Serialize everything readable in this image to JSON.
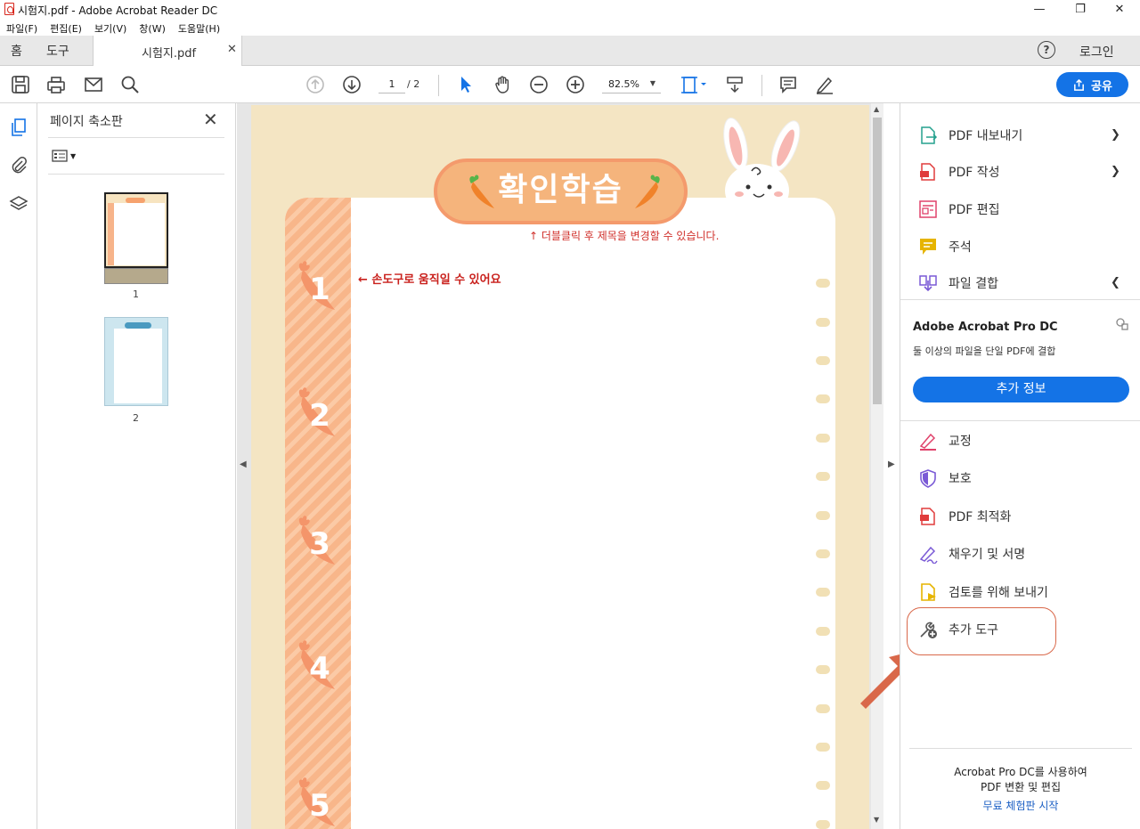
{
  "window": {
    "title": "시험지.pdf - Adobe Acrobat Reader DC",
    "controls": [
      "minimize",
      "restore",
      "close"
    ]
  },
  "menu": [
    "파일(F)",
    "편집(E)",
    "보기(V)",
    "창(W)",
    "도움말(H)"
  ],
  "tabs": {
    "home": "홈",
    "tools": "도구",
    "document": "시험지.pdf",
    "login": "로그인"
  },
  "toolbar": {
    "page_current": "1",
    "page_total": "/ 2",
    "zoom": "82.5%",
    "share_label": "공유"
  },
  "thumbnails": {
    "header": "페이지 축소판",
    "pages": [
      "1",
      "2"
    ]
  },
  "document": {
    "title": "확인학습",
    "hint_title": "↑ 더블클릭 후 제목을 변경할 수 있습니다.",
    "hint_hand": "← 손도구로 움직일 수 있어요",
    "numbers": [
      "1",
      "2",
      "3",
      "4",
      "5"
    ]
  },
  "right_panel": {
    "tools": [
      {
        "label": "PDF 내보내기",
        "icon": "export-pdf-icon",
        "chevron": "down"
      },
      {
        "label": "PDF 작성",
        "icon": "create-pdf-icon",
        "chevron": "down"
      },
      {
        "label": "PDF 편집",
        "icon": "edit-pdf-icon"
      },
      {
        "label": "주석",
        "icon": "comment-icon"
      },
      {
        "label": "파일 결합",
        "icon": "combine-files-icon",
        "chevron": "up"
      }
    ],
    "promo": {
      "title": "Adobe Acrobat Pro DC",
      "desc": "둘 이상의 파일을 단일 PDF에 결합",
      "button": "추가 정보"
    },
    "more_tools": [
      {
        "label": "교정",
        "icon": "redact-icon"
      },
      {
        "label": "보호",
        "icon": "protect-icon"
      },
      {
        "label": "PDF 최적화",
        "icon": "optimize-pdf-icon"
      },
      {
        "label": "채우기 및 서명",
        "icon": "fill-sign-icon"
      },
      {
        "label": "검토를 위해 보내기",
        "icon": "send-review-icon"
      },
      {
        "label": "추가 도구",
        "icon": "more-tools-icon"
      }
    ],
    "bottom": {
      "line1": "Acrobat Pro DC를 사용하여",
      "line2": "PDF 변환 및 편집",
      "trial": "무료 체험판 시작"
    }
  },
  "colors": {
    "accent": "#1473e6",
    "page_bg": "#f4e5c3",
    "stripe": "#f8b68a",
    "title_pill": "#f5b47c",
    "annotation": "#d9684a"
  }
}
